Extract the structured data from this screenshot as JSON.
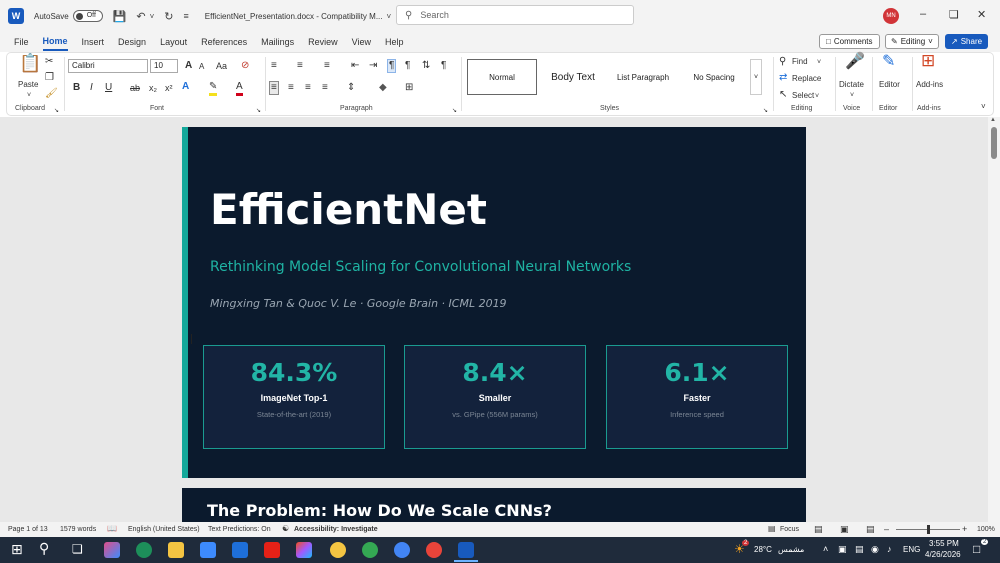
{
  "window": {
    "autosave_label": "AutoSave",
    "autosave_state": "Off",
    "doc_title": "EfficientNet_Presentation.docx  -  Compatibility M...",
    "search_placeholder": "Search",
    "user_initials": "MN"
  },
  "menu": {
    "tabs": [
      "File",
      "Home",
      "Insert",
      "Design",
      "Layout",
      "References",
      "Mailings",
      "Review",
      "View",
      "Help"
    ],
    "active": "Home",
    "comments_label": "Comments",
    "editing_label": "Editing",
    "share_label": "Share"
  },
  "ribbon": {
    "paste_label": "Paste",
    "clipboard_label": "Clipboard",
    "font_name": "Calibri",
    "font_size": "10",
    "font_label": "Font",
    "paragraph_label": "Paragraph",
    "styles_label": "Styles",
    "styles": [
      "Normal",
      "Body Text",
      "List Paragraph",
      "No Spacing"
    ],
    "find_label": "Find",
    "replace_label": "Replace",
    "select_label": "Select",
    "editing_group_label": "Editing",
    "dictate_label": "Dictate",
    "voice_label": "Voice",
    "editor_label": "Editor",
    "editor_group_label": "Editor",
    "addins_label": "Add-ins",
    "addins_group_label": "Add-ins"
  },
  "slide1": {
    "title": "EfficientNet",
    "subtitle": "Rethinking Model Scaling for Convolutional Neural Networks",
    "authors": "Mingxing Tan & Quoc V. Le  ·  Google Brain  ·  ICML 2019",
    "cards": [
      {
        "value": "84.3%",
        "label": "ImageNet Top-1",
        "desc": "State-of-the-art (2019)"
      },
      {
        "value": "8.4×",
        "label": "Smaller",
        "desc": "vs. GPipe (556M params)"
      },
      {
        "value": "6.1×",
        "label": "Faster",
        "desc": "Inference speed"
      }
    ]
  },
  "slide2": {
    "title": "The Problem: How Do We Scale CNNs?"
  },
  "status": {
    "page": "Page 1 of 13",
    "words": "1579 words",
    "language": "English (United States)",
    "predictions": "Text Predictions: On",
    "accessibility": "Accessibility: Investigate",
    "focus": "Focus",
    "zoom": "100%"
  },
  "taskbar": {
    "weather": "28°C",
    "weather_text": "مشمس",
    "lang": "ENG",
    "time": "3:55 PM",
    "date": "4/26/2026",
    "notif_count": "2",
    "weather_badge": "2"
  },
  "colors": {
    "accent": "#185abd",
    "slide_bg": "#0b1a2d",
    "teal": "#1fb3a3"
  }
}
